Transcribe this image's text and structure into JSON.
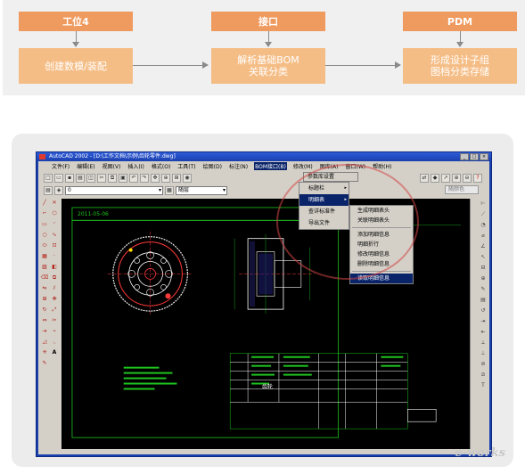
{
  "flow": {
    "headers": [
      "工位4",
      "接口",
      "PDM"
    ],
    "boxes": [
      "创建数模/装配",
      "解析基础BOM\n关联分类",
      "形成设计子组\n图档分类存储"
    ],
    "colors": {
      "header": "#ef9a5e",
      "box": "#f5bd86",
      "connector": "#8a8a8a"
    }
  },
  "window": {
    "title": "AutoCAD 2002 - [D:\\工作文档\\示例\\齿轮零件.dwg]",
    "buttons": {
      "minimize": "_",
      "maximize": "□",
      "close": "×"
    },
    "menus": [
      "文件(F)",
      "编辑(E)",
      "视图(V)",
      "插入(I)",
      "格式(O)",
      "工具(T)",
      "绘图(D)",
      "标注(N)",
      "BOM接口(B)",
      "修改(M)",
      "图库(A)",
      "窗口(W)",
      "帮助(H)"
    ],
    "layer_value": "0",
    "linetype_value": "随层",
    "right_box": "随颜色",
    "top_submenu_label": "参数库设置"
  },
  "menu_bom": {
    "items": [
      "标题栏",
      "明细表",
      "查详标准件",
      "导出文件"
    ]
  },
  "menu_detail": {
    "items": [
      "生成明细表头",
      "关联明细表头",
      "添加明细信息",
      "明细折行",
      "修改明细信息",
      "删除明细信息",
      "读取明细信息"
    ]
  },
  "drawing": {
    "date_text": "2011-05-06",
    "block_text": "齿轮"
  },
  "watermark": "e-works",
  "icons": {
    "left_tools": [
      "line-icon",
      "xline-icon",
      "pline-icon",
      "polygon-icon",
      "rectangle-icon",
      "arc-icon",
      "circle-icon",
      "spline-icon",
      "ellipse-icon",
      "insert-icon",
      "block-icon",
      "point-icon",
      "hatch-icon",
      "region-icon",
      "text-icon",
      "erase-icon",
      "copy-icon",
      "mirror-icon",
      "offset-icon",
      "array-icon",
      "move-icon",
      "rotate-icon",
      "scale-icon",
      "stretch-icon"
    ],
    "right_tools": [
      "dim-linear-icon",
      "dim-aligned-icon",
      "dim-radius-icon",
      "dim-diameter-icon",
      "dim-angle-icon",
      "leader-icon",
      "tolerance-icon",
      "center-icon",
      "dim-edit-icon"
    ]
  }
}
